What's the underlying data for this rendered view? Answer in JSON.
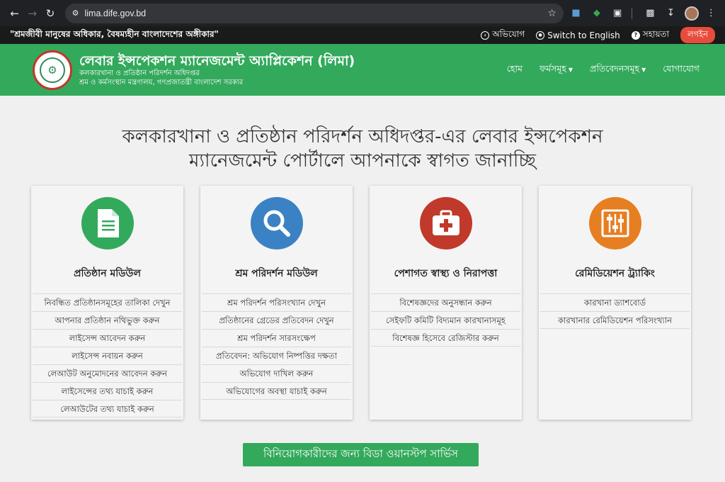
{
  "browser": {
    "url": "lima.dife.gov.bd"
  },
  "topbar": {
    "slogan": "\"শ্রমজীবী মানুষের অধিকার, বৈষম্যহীন বাংলাদেশের অঙ্গীকার\"",
    "complaint": "অভিযোগ",
    "english": "Switch to English",
    "help": "সহায়তা",
    "login": "লগইন"
  },
  "header": {
    "title": "লেবার ইন্সপেকশন ম্যানেজমেন্ট অ্যাপ্লিকেশন (লিমা)",
    "subtitle1": "কলকারখানা ও প্রতিষ্ঠান পরিদর্শন অধিদপ্তর",
    "subtitle2": "শ্রম ও কর্মসংস্থান মন্ত্রণালয়, গণপ্রজাতন্ত্রী বাংলাদেশ সরকার",
    "menu": {
      "home": "হোম",
      "forms": "ফর্মসমূহ",
      "reports": "প্রতিবেদনসমূহ",
      "contact": "যোগাযোগ"
    }
  },
  "welcome": {
    "line1": "কলকারখানা ও প্রতিষ্ঠান পরিদর্শন অধিদপ্তর-এর লেবার ইন্সপেকশন",
    "line2": "ম্যানেজমেন্ট পোর্টালে আপনাকে স্বাগত জানাচ্ছি"
  },
  "colors": {
    "green": "#33a95c",
    "blue": "#3b82c4",
    "red": "#c0392b",
    "orange": "#e67e22"
  },
  "cards": [
    {
      "title": "প্রতিষ্ঠান মডিউল",
      "icon": "document-icon",
      "links": [
        "নিবন্ধিত প্রতিষ্ঠানসমূহের তালিকা দেখুন",
        "আপনার প্রতিষ্ঠান নথিভুক্ত করুন",
        "লাইসেন্স আবেদন করুন",
        "লাইসেন্স নবায়ন করুন",
        "লেআউট অনুমোদনের আবেদন করুন",
        "লাইসেন্সের তথ্য যাচাই করুন",
        "লেআউটের তথ্য যাচাই করুন"
      ]
    },
    {
      "title": "শ্রম পরিদর্শন মডিউল",
      "icon": "search-icon",
      "links": [
        "শ্রম পরিদর্শন পরিসংখ্যান দেখুন",
        "প্রতিষ্ঠানের গ্রেডের প্রতিবেদন দেখুন",
        "শ্রম পরিদর্শন সারসংক্ষেপ",
        "প্রতিবেদন: অভিযোগ নিষ্পত্তির দক্ষতা",
        "অভিযোগ দাখিল করুন",
        "অভিযোগের অবস্থা যাচাই করুন"
      ]
    },
    {
      "title": "পেশাগত স্বাস্থ্য ও নিরাপত্তা",
      "icon": "first-aid-kit-icon",
      "links": [
        "বিশেষজ্ঞদের অনুসন্ধান করুন",
        "সেইফটি কমিটি বিদ্যমান কারখানাসমূহ",
        "বিশেষজ্ঞ হিসেবে রেজিস্টার করুন"
      ]
    },
    {
      "title": "রেমিডিয়েশন ট্র্যাকিং",
      "icon": "sliders-icon",
      "links": [
        "কারখানা ড্যাশবোর্ড",
        "কারখানার রেমিডিয়েশন পরিসংখ্যান"
      ]
    }
  ],
  "bottom_button": "বিনিয়োগকারীদের জন্য বিডা ওয়ানস্টপ সার্ভিস"
}
